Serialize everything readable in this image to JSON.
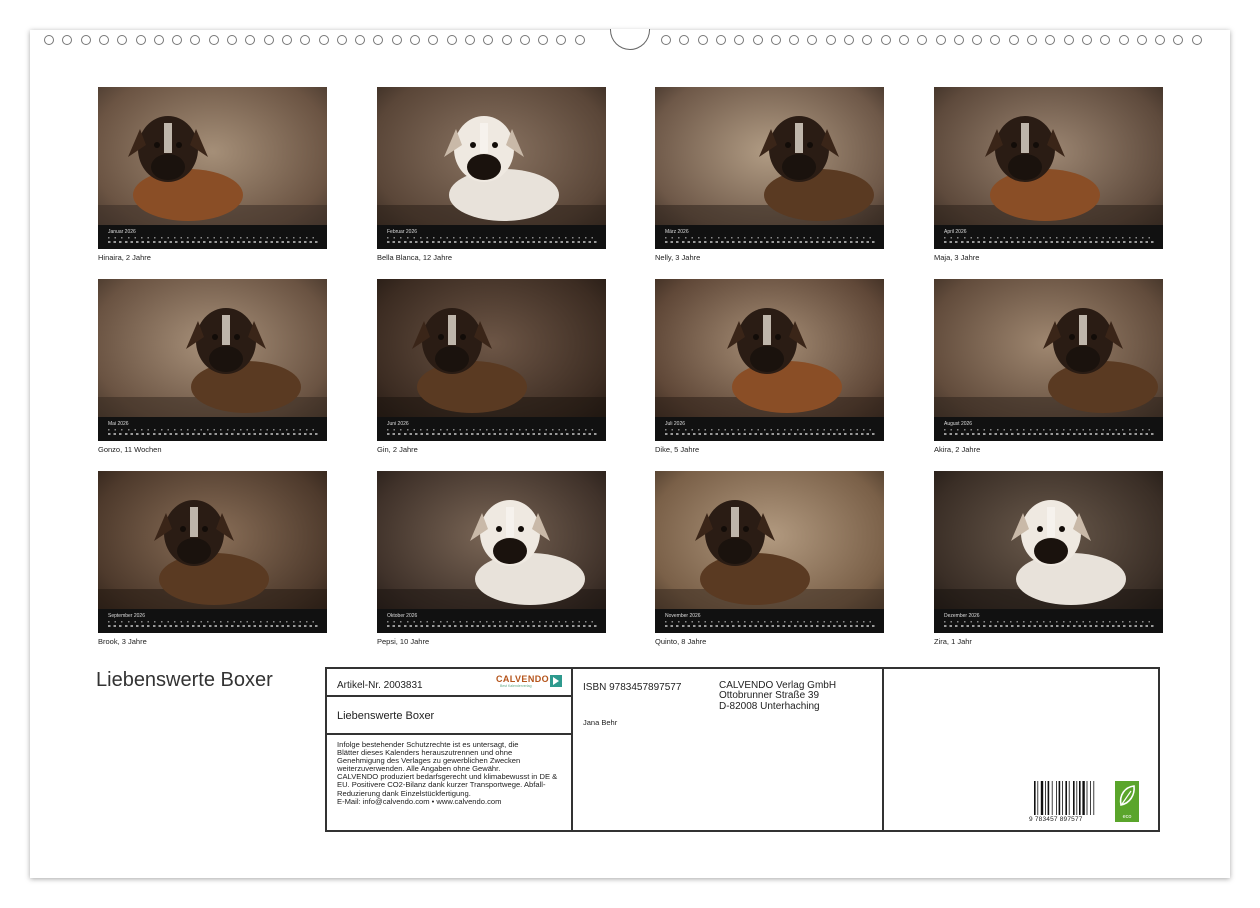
{
  "title": "Liebenswerte Boxer",
  "months": [
    {
      "month": "Januar 2026",
      "name": "Hinaira, 2 Jahre"
    },
    {
      "month": "Februar 2026",
      "name": "Bella Blanca, 12 Jahre"
    },
    {
      "month": "März 2026",
      "name": "Nelly, 3 Jahre"
    },
    {
      "month": "April 2026",
      "name": "Maja, 3 Jahre"
    },
    {
      "month": "Mai 2026",
      "name": "Gonzo, 11 Wochen"
    },
    {
      "month": "Juni 2026",
      "name": "Gin, 2 Jahre"
    },
    {
      "month": "Juli 2026",
      "name": "Dike, 5 Jahre"
    },
    {
      "month": "August 2026",
      "name": "Akira, 2 Jahre"
    },
    {
      "month": "September 2026",
      "name": "Brook, 3 Jahre"
    },
    {
      "month": "Oktober 2026",
      "name": "Pepsi, 10 Jahre"
    },
    {
      "month": "November 2026",
      "name": "Quinto, 8 Jahre"
    },
    {
      "month": "Dezember 2026",
      "name": "Zira, 1 Jahr"
    }
  ],
  "info": {
    "artikel": "Artikel-Nr. 2003831",
    "logo": "CALVENDO",
    "logo_sub": "Best Kalenderverlag",
    "box_title": "Liebenswerte Boxer",
    "legal": [
      "Infolge bestehender Schutzrechte ist es untersagt, die",
      "Blätter dieses Kalenders herauszutrennen und ohne",
      "Genehmigung des Verlages zu gewerblichen Zwecken",
      "weiterzuverwenden. Alle Angaben ohne Gewähr.",
      "CALVENDO produziert bedarfsgerecht und klimabewusst in DE &",
      "EU. Positivere CO2-Bilanz dank kurzer Transportwege. Abfall-",
      "Reduzierung dank Einzelstückfertigung.",
      "E-Mail: info@calvendo.com • www.calvendo.com"
    ],
    "isbn": "ISBN 9783457897577",
    "author": "Jana Behr",
    "publisher": [
      "CALVENDO Verlag GmbH",
      "Ottobrunner Straße 39",
      "D-82008 Unterhaching"
    ],
    "barcode": "9 783457 897577",
    "eco": "eco"
  }
}
